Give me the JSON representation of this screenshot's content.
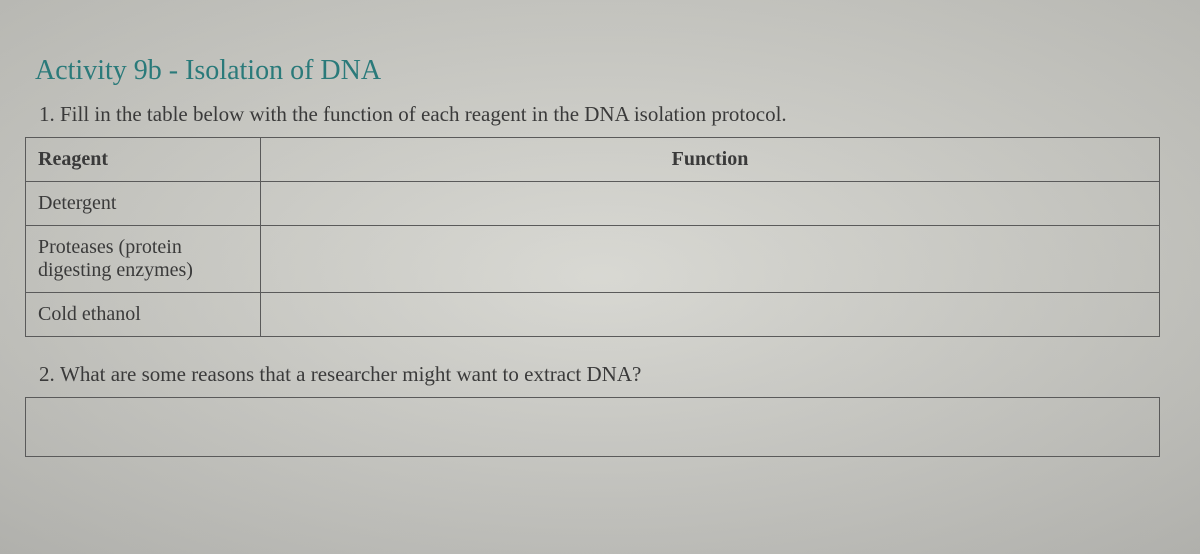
{
  "title": "Activity 9b - Isolation of DNA",
  "questions": {
    "q1": "Fill in the table below with the function of each reagent in the DNA isolation protocol.",
    "q2": "What are some reasons that a researcher might want to extract DNA?"
  },
  "table": {
    "headers": {
      "reagent": "Reagent",
      "function": "Function"
    },
    "rows": [
      {
        "reagent": "Detergent",
        "function": ""
      },
      {
        "reagent": "Proteases (protein digesting enzymes)",
        "function": ""
      },
      {
        "reagent": "Cold ethanol",
        "function": ""
      }
    ]
  }
}
